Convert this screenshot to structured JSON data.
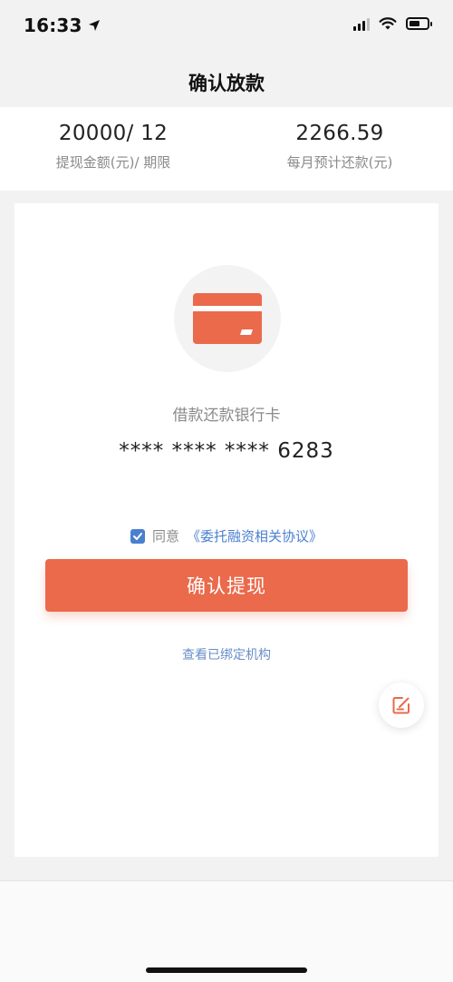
{
  "status_bar": {
    "time": "16:33"
  },
  "nav": {
    "title": "确认放款"
  },
  "summary": {
    "amount_term_value": "20000/ 12",
    "amount_term_label": "提现金额(元)/ 期限",
    "monthly_value": "2266.59",
    "monthly_label": "每月预计还款(元)"
  },
  "card": {
    "bank_label": "借款还款银行卡",
    "card_number": "**** **** **** 6283"
  },
  "agreement": {
    "checked": true,
    "prefix": "同意",
    "link": "《委托融资相关协议》"
  },
  "actions": {
    "confirm_label": "确认提现",
    "view_bound_label": "查看已绑定机构"
  },
  "icons": {
    "location": "location-arrow-icon",
    "signal": "signal-icon",
    "wifi": "wifi-icon",
    "battery": "battery-icon",
    "bank_card": "bank-card-icon",
    "checkbox": "checkbox-checked-icon",
    "edit": "edit-icon"
  },
  "colors": {
    "accent": "#ea6a4b",
    "link": "#4a7fd0"
  }
}
